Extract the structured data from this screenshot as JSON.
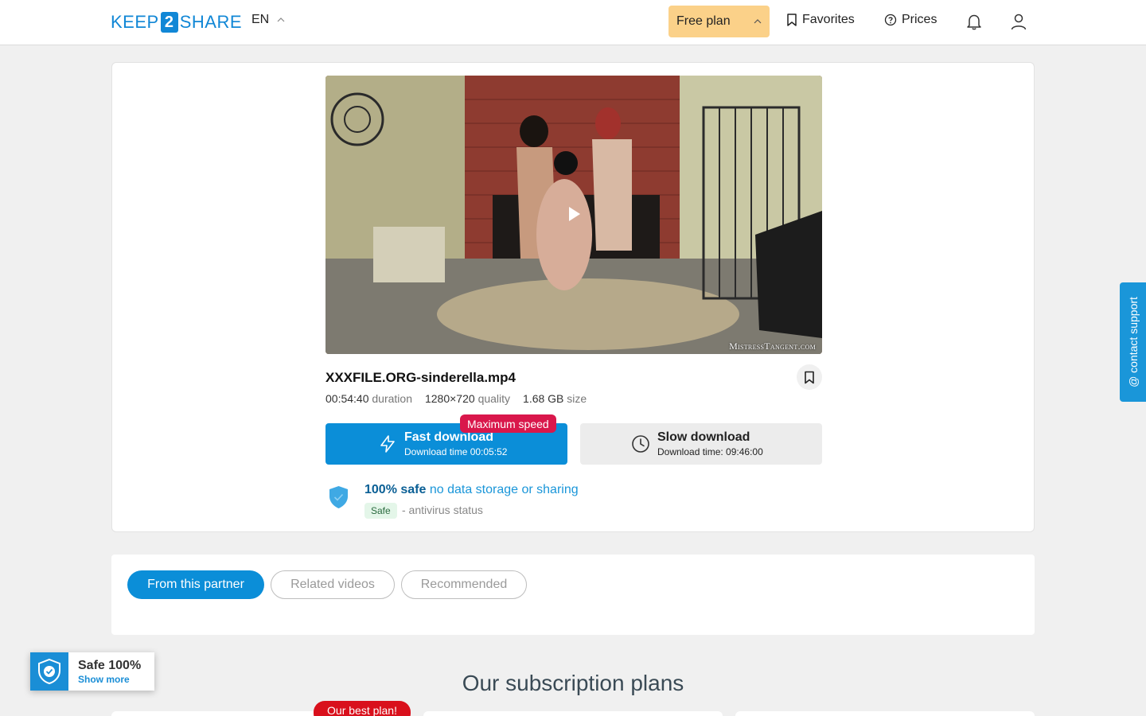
{
  "header": {
    "logo_left": "KEEP",
    "logo_num": "2",
    "logo_right": "SHARE",
    "lang": "EN",
    "plan_label": "Free plan",
    "favorites_label": "Favorites",
    "prices_label": "Prices"
  },
  "file": {
    "video_watermark": "MistressTangent.com",
    "name": "XXXFILE.ORG-sinderella.mp4",
    "duration_value": "00:54:40",
    "duration_label": "duration",
    "quality_value": "1280×720",
    "quality_label": "quality",
    "size_value": "1.68 GB",
    "size_label": "size"
  },
  "downloads": {
    "badge": "Maximum speed",
    "fast_title": "Fast download",
    "fast_sub": "Download time 00:05:52",
    "slow_title": "Slow download",
    "slow_sub": "Download time: 09:46:00"
  },
  "safety": {
    "bold": "100% safe",
    "rest": "no data storage or sharing",
    "tag": "Safe",
    "status": "- antivirus status"
  },
  "tabs": [
    "From this partner",
    "Related videos",
    "Recommended"
  ],
  "plans": {
    "title": "Our subscription plans",
    "best_badge": "Our best plan!"
  },
  "support": {
    "label": "contact support",
    "icon": "@"
  },
  "safe_widget": {
    "title": "Safe 100%",
    "link": "Show more"
  },
  "colors": {
    "accent": "#0b8ed8",
    "plan_button": "#fbd189",
    "badge_red": "#d9174b"
  }
}
